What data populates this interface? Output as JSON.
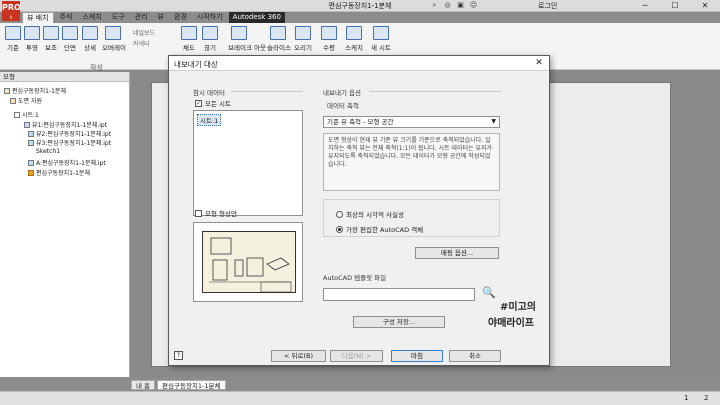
{
  "app": {
    "logo_text": "PRO",
    "logo_sub": "I",
    "doc_title": "편심구동장치1-1분체",
    "login_label": "로그인"
  },
  "window_controls": {
    "minimize": "─",
    "maximize": "☐",
    "close": "✕"
  },
  "ribbon_tabs": [
    {
      "label": "뷰 배치"
    },
    {
      "label": "주석"
    },
    {
      "label": "스케치"
    },
    {
      "label": "도구"
    },
    {
      "label": "관리"
    },
    {
      "label": "뷰"
    },
    {
      "label": "환경"
    },
    {
      "label": "시작하기"
    },
    {
      "label": "Autodesk 360"
    }
  ],
  "ribbon_buttons": [
    {
      "label": "기준"
    },
    {
      "label": "투영"
    },
    {
      "label": "보조"
    },
    {
      "label": "단면"
    },
    {
      "label": "상세"
    },
    {
      "label": "오버레이"
    },
    {
      "label": "채도"
    },
    {
      "label": "끊기"
    },
    {
      "label": "브레이크 아웃"
    },
    {
      "label": "슬라이스"
    },
    {
      "label": "오리기"
    },
    {
      "label": "수평"
    },
    {
      "label": "스케치"
    },
    {
      "label": "새 시트"
    }
  ],
  "ribbon_small": {
    "nailboard": "네일보드",
    "connector": "커넥터"
  },
  "ribbon_panel_label": "작성",
  "browser": {
    "header": "모형",
    "items": [
      {
        "label": "편심구동장치1-1분체"
      },
      {
        "label": "도면 자원"
      },
      {
        "label": "시트:1"
      },
      {
        "label": "뷰1:편심구동장치1-1분체.ipt"
      },
      {
        "label": "뷰2:편심구동장치1-1분체.ipt"
      },
      {
        "label": "뷰3:편심구동장치1-1분체.ipt"
      },
      {
        "label": "Sketch1"
      },
      {
        "label": "A:편심구동장치1-1분체.ipt"
      },
      {
        "label": "편심구동장치1-1분체"
      }
    ]
  },
  "doc_tabs": {
    "home": "내 홈",
    "document": "편심구동장치1-1분체"
  },
  "status": {
    "page_left": "1",
    "page_right": "2"
  },
  "dialog": {
    "title": "내보내기 대상",
    "close": "✕",
    "left_section": "참시 데이터",
    "all_sheets_label": "모든 시트",
    "all_sheets_checked": true,
    "sheet_item": "시트:1",
    "model_geometry_label": "모형 형상만",
    "model_geometry_checked": false,
    "right_section": "내보내기 옵션",
    "data_scale_label": "데이터 축척",
    "scale_dropdown": "기준 뷰 축척 - 모형 공간",
    "scale_description": "도면 형상이 현재 뷰 기준 뷰 크기를 기준으로 축척되었습니다. 일치하는 축척 뷰는 전체 축척(1:1)이 됩니다. 시트 데이터는 유지가 유지되도록 축척되었습니다. 모든 데이터가 모형 공간에 작성되었습니다.",
    "radio_1": "최상의 시각적 사실성",
    "radio_2": "가장 편집한 AutoCAD 객체",
    "radio_selected": 2,
    "mapping_button": "매핑 옵션...",
    "template_label": "AutoCAD 템플릿 파일",
    "template_value": "",
    "save_config_button": "구성 저장...",
    "back_button": "< 뒤로(B)",
    "next_button": "다음(N) >",
    "finish_button": "마침",
    "cancel_button": "취소",
    "help": "?"
  },
  "watermark": {
    "line1": "#미고의",
    "line2": "야매라이프"
  },
  "colors": {
    "accent": "#3c7fc4",
    "brand": "#c8341f"
  }
}
